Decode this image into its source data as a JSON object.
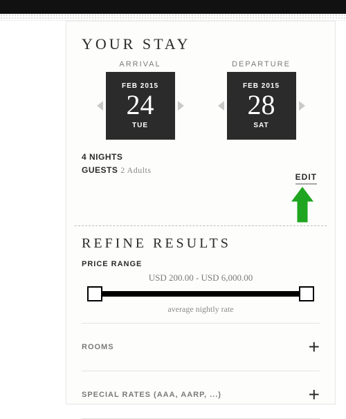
{
  "stay": {
    "heading": "YOUR STAY",
    "arrival_label": "ARRIVAL",
    "departure_label": "DEPARTURE",
    "arrival": {
      "month": "FEB 2015",
      "day": "24",
      "dow": "TUE"
    },
    "departure": {
      "month": "FEB 2015",
      "day": "28",
      "dow": "SAT"
    },
    "nights_label": "4 NIGHTS",
    "guests_label": "GUESTS",
    "guests_value": "2 Adults",
    "edit_label": "EDIT"
  },
  "refine": {
    "heading": "REFINE RESULTS",
    "price_label": "PRICE RANGE",
    "price_text": "USD 200.00 - USD 6,000.00",
    "rate_note": "average nightly rate",
    "rooms_label": "ROOMS",
    "special_label": "SPECIAL RATES (AAA, AARP, ...)"
  }
}
